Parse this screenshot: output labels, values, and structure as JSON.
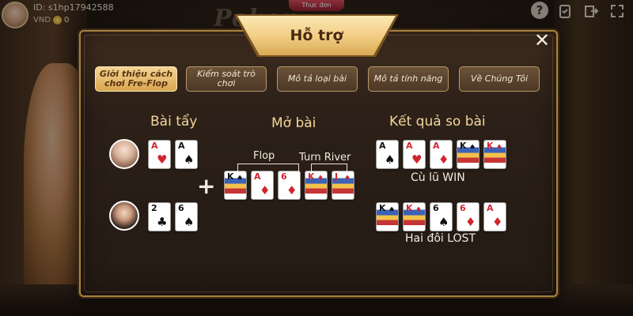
{
  "topbar": {
    "user_id": "ID: s1hp17942588",
    "currency": "VND",
    "balance": "0",
    "menu": "Thực đơn",
    "logo": "Poker"
  },
  "dialog": {
    "title": "Hỗ trợ",
    "close": "✕"
  },
  "tabs": [
    {
      "label": "Giới thiệu cách chơi Fre-Flop",
      "active": true
    },
    {
      "label": "Kiểm soát trò chơi",
      "active": false
    },
    {
      "label": "Mô tả loại bài",
      "active": false
    },
    {
      "label": "Mô tả tính năng",
      "active": false
    },
    {
      "label": "Về Chúng Tôi",
      "active": false
    }
  ],
  "headers": {
    "hole": "Bài tẩy",
    "community": "Mở bài",
    "result": "Kết quả so bài"
  },
  "community_labels": {
    "flop": "Flop",
    "turn_river": "Turn River"
  },
  "hands": {
    "player1": [
      {
        "rank": "A",
        "suit": "♥",
        "color": "red"
      },
      {
        "rank": "A",
        "suit": "♠",
        "color": "black"
      }
    ],
    "player2": [
      {
        "rank": "2",
        "suit": "♣",
        "color": "black"
      },
      {
        "rank": "6",
        "suit": "♠",
        "color": "black"
      }
    ],
    "community": [
      {
        "rank": "K",
        "suit": "♠",
        "color": "black",
        "face": true
      },
      {
        "rank": "A",
        "suit": "♦",
        "color": "red"
      },
      {
        "rank": "6",
        "suit": "♦",
        "color": "red"
      },
      {
        "rank": "K",
        "suit": "♦",
        "color": "red",
        "face": true
      },
      {
        "rank": "J",
        "suit": "♦",
        "color": "red",
        "face": true
      }
    ],
    "result1": [
      {
        "rank": "A",
        "suit": "♠",
        "color": "black"
      },
      {
        "rank": "A",
        "suit": "♥",
        "color": "red"
      },
      {
        "rank": "A",
        "suit": "♦",
        "color": "red"
      },
      {
        "rank": "K",
        "suit": "♠",
        "color": "black",
        "face": true
      },
      {
        "rank": "K",
        "suit": "♦",
        "color": "red",
        "face": true
      }
    ],
    "result2": [
      {
        "rank": "K",
        "suit": "♠",
        "color": "black",
        "face": true
      },
      {
        "rank": "K",
        "suit": "♦",
        "color": "red",
        "face": true
      },
      {
        "rank": "6",
        "suit": "♠",
        "color": "black"
      },
      {
        "rank": "6",
        "suit": "♦",
        "color": "red"
      },
      {
        "rank": "A",
        "suit": "♦",
        "color": "red"
      }
    ]
  },
  "results": {
    "win": "Cù lũ WIN",
    "lost": "Hai đôi LOST"
  },
  "top_icons": [
    "help-icon",
    "clipboard-icon",
    "exit-icon",
    "fullscreen-icon"
  ]
}
